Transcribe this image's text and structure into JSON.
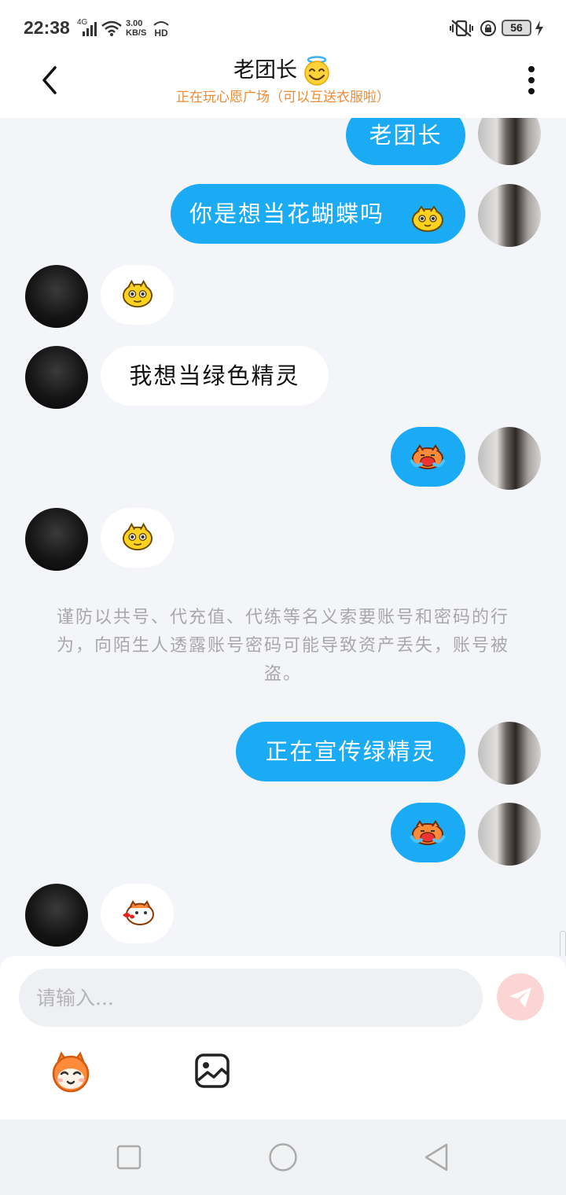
{
  "status_bar": {
    "time": "22:38",
    "network": "4G",
    "speed_value": "3.00",
    "speed_unit": "KB/S",
    "hd": "HD",
    "battery": "56"
  },
  "header": {
    "title": "老团长",
    "subtitle": "正在玩心愿广场（可以互送衣服啦）"
  },
  "messages": [
    {
      "from": "self",
      "type": "text",
      "text": "老团长"
    },
    {
      "from": "self",
      "type": "text",
      "text": "你是想当花蝴蝶吗"
    },
    {
      "from": "other",
      "type": "sticker",
      "icon": "yellow-chick-sticker-icon"
    },
    {
      "from": "other",
      "type": "text",
      "text": "我想当绿色精灵"
    },
    {
      "from": "self",
      "type": "sticker",
      "icon": "crying-tiger-sticker-icon"
    },
    {
      "from": "other",
      "type": "sticker",
      "icon": "yellow-chick-sticker-icon"
    },
    {
      "from": "system",
      "type": "notice",
      "text": "谨防以共号、代充值、代练等名义索要账号和密码的行为，向陌生人透露账号密码可能导致资产丢失，账号被盗。"
    },
    {
      "from": "self",
      "type": "text",
      "text": "正在宣传绿精灵"
    },
    {
      "from": "self",
      "type": "sticker",
      "icon": "crying-tiger-sticker-icon"
    },
    {
      "from": "other",
      "type": "sticker",
      "icon": "kissing-tiger-sticker-icon"
    }
  ],
  "input": {
    "placeholder": "请输入..."
  },
  "colors": {
    "self_bubble": "#1aabf4",
    "other_bubble": "#ffffff",
    "subtitle": "#f08a34",
    "background": "#f4f5f8"
  }
}
